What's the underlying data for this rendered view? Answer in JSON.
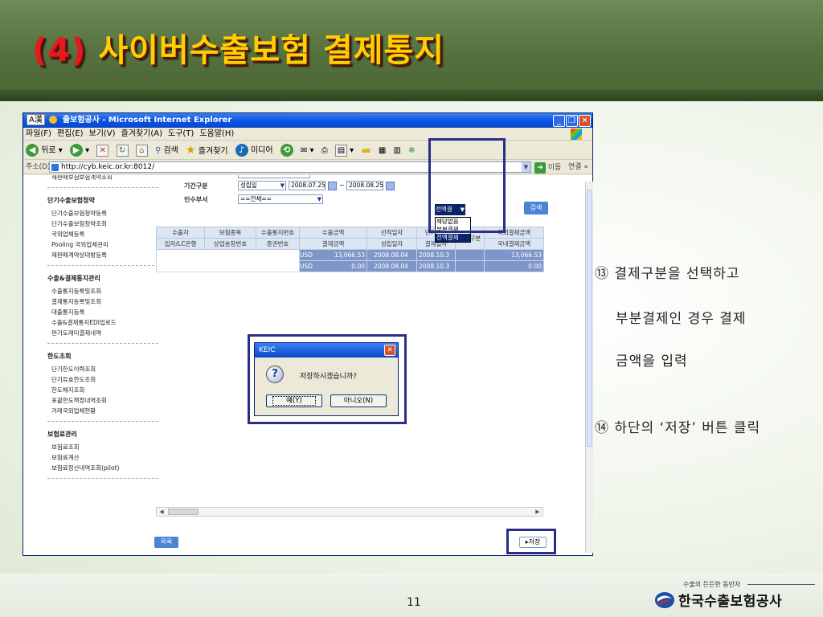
{
  "slide": {
    "title_number": "(4)",
    "title_text": " 사이버수출보험 결제통지",
    "page_number": "11"
  },
  "browser": {
    "ime": "A漢",
    "title": "출보험공사 - Microsoft Internet Explorer",
    "menu": [
      "파일(F)",
      "편집(E)",
      "보기(V)",
      "즐겨찾기(A)",
      "도구(T)",
      "도움말(H)"
    ],
    "toolbar": {
      "back": "뒤로",
      "search": "검색",
      "favorites": "즐겨찾기",
      "media": "미디어"
    },
    "address_label": "주소(D)",
    "address_url": "http://cyb.keic.or.kr:8012/",
    "go_label": "이동",
    "links_label": "연결 »"
  },
  "left_nav": {
    "top_cut": "재판매보험보험계약조회",
    "groups": [
      {
        "title": "단기수출보험청약",
        "items": [
          "단기수출보험청약등록",
          "단기수출보험청약조회",
          "국외업체등록",
          "Pooling 국외업체관리",
          "재판매계약상대방등록"
        ]
      },
      {
        "title": "수출&결제통지관리",
        "items": [
          "수출통지등록및조회",
          "결제통지등록및조회",
          "대출통지등록",
          "수출&결제통지EDI업로드",
          "판기도래미결제내역"
        ]
      },
      {
        "title": "한도조회",
        "items": [
          "단기한도이력조회",
          "단기유효한도조회",
          "한도해지조회",
          "포괄한도책정내역조회",
          "거래국외업체현황"
        ]
      },
      {
        "title": "보험료관리",
        "items": [
          "보험료조회",
          "보험료계산",
          "보험료정산내역조회(pilot)"
        ]
      }
    ]
  },
  "search_form": {
    "period_label": "기간구분",
    "period_value": "성립일",
    "date_from": "2008.07.25",
    "date_separator": "~",
    "date_to": "2008.08.25",
    "dept_label": "인수부서",
    "dept_value": "==전체==",
    "search_button": "검색"
  },
  "grid": {
    "header_row1": [
      "수출자",
      "보험종목",
      "수출통지번호",
      "수출금액",
      "선적일자",
      "만기일자",
      "결제구분",
      "국외결제금액"
    ],
    "header_row2": [
      "입자/LC은행",
      "상업송장번호",
      "증권번호",
      "결제금액",
      "성립일자",
      "결제일자",
      "국내결제금액"
    ],
    "rows": [
      {
        "currency": "USD",
        "amount": "13,066.53",
        "date1": "2008.08.04",
        "date2": "2008.10.3",
        "settle_amount": "13,066.53"
      },
      {
        "currency": "USD",
        "amount": "0.00",
        "date1": "2008.08.04",
        "date2": "2008.10.3",
        "settle_amount": "0.00"
      }
    ]
  },
  "settle_select": {
    "selected": "전액결",
    "options": [
      "해당없음",
      "부분결제",
      "전액결제"
    ],
    "selected_option_index": 2
  },
  "buttons": {
    "list": "목록",
    "save": "▸저장"
  },
  "dialog": {
    "title": "KEIC",
    "message": "저장하시겠습니까?",
    "yes": "예(Y)",
    "no": "아니오(N)"
  },
  "instructions": {
    "step13_line1": "⑬ 결제구분을 선택하고",
    "step13_line2": "부분결제인 경우 결제",
    "step13_line3": "금액을 입력",
    "step14": "⑭ 하단의 ‘저장’ 버튼 클릭"
  },
  "company": {
    "tagline": "수출의 든든한 동반자",
    "name": "한국수출보험공사"
  },
  "colors": {
    "title_yellow": "#ffd000",
    "title_red": "#e8181c",
    "highlight_box": "#2b2e86",
    "xp_blue": "#0b55e4",
    "grid_row": "#7e97c8"
  }
}
